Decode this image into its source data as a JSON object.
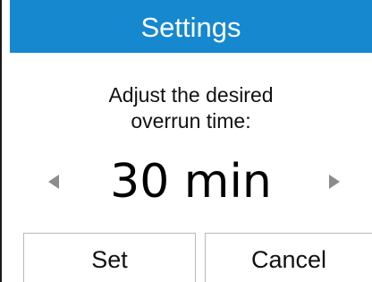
{
  "header": {
    "title": "Settings",
    "color": "#1588d0"
  },
  "prompt": {
    "line1": "Adjust the desired",
    "line2": "overrun time:"
  },
  "value": {
    "display": "30 min",
    "decrease_icon": "chevron-left-icon",
    "increase_icon": "chevron-right-icon"
  },
  "buttons": {
    "set_label": "Set",
    "cancel_label": "Cancel"
  }
}
